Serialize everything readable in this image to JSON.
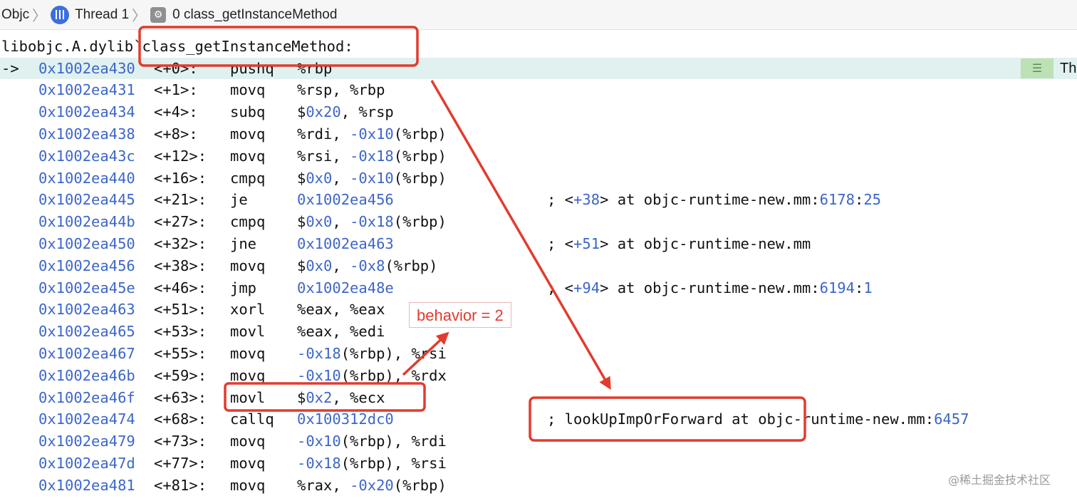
{
  "breadcrumb": {
    "items": [
      "Objc",
      "Thread 1",
      "0 class_getInstanceMethod"
    ],
    "separator": "〉"
  },
  "disassembly": {
    "function_header": "libobjc.A.dylib`class_getInstanceMethod:",
    "current_arrow": "->",
    "side_indicator": "Th",
    "rows": [
      {
        "addr": "0x1002ea430",
        "offset": "<+0>:",
        "op": "pushq",
        "args": [
          {
            "t": "%rbp"
          }
        ],
        "comment": [],
        "current": true
      },
      {
        "addr": "0x1002ea431",
        "offset": "<+1>:",
        "op": "movq",
        "args": [
          {
            "t": "%rsp, %rbp"
          }
        ],
        "comment": []
      },
      {
        "addr": "0x1002ea434",
        "offset": "<+4>:",
        "op": "subq",
        "args": [
          {
            "t": "$"
          },
          {
            "t": "0x20",
            "n": true
          },
          {
            "t": ", %rsp"
          }
        ],
        "comment": []
      },
      {
        "addr": "0x1002ea438",
        "offset": "<+8>:",
        "op": "movq",
        "args": [
          {
            "t": "%rdi, "
          },
          {
            "t": "-0x10",
            "n": true
          },
          {
            "t": "(%rbp)"
          }
        ],
        "comment": []
      },
      {
        "addr": "0x1002ea43c",
        "offset": "<+12>:",
        "op": "movq",
        "args": [
          {
            "t": "%rsi, "
          },
          {
            "t": "-0x18",
            "n": true
          },
          {
            "t": "(%rbp)"
          }
        ],
        "comment": []
      },
      {
        "addr": "0x1002ea440",
        "offset": "<+16>:",
        "op": "cmpq",
        "args": [
          {
            "t": "$"
          },
          {
            "t": "0x0",
            "n": true
          },
          {
            "t": ", "
          },
          {
            "t": "-0x10",
            "n": true
          },
          {
            "t": "(%rbp)"
          }
        ],
        "comment": []
      },
      {
        "addr": "0x1002ea445",
        "offset": "<+21>:",
        "op": "je",
        "args": [
          {
            "t": "0x1002ea456",
            "n": true
          }
        ],
        "comment": [
          {
            "t": "; <"
          },
          {
            "t": "+38",
            "n": true
          },
          {
            "t": "> at objc-runtime-new.mm:"
          },
          {
            "t": "6178",
            "n": true
          },
          {
            "t": ":"
          },
          {
            "t": "25",
            "n": true
          }
        ]
      },
      {
        "addr": "0x1002ea44b",
        "offset": "<+27>:",
        "op": "cmpq",
        "args": [
          {
            "t": "$"
          },
          {
            "t": "0x0",
            "n": true
          },
          {
            "t": ", "
          },
          {
            "t": "-0x18",
            "n": true
          },
          {
            "t": "(%rbp)"
          }
        ],
        "comment": []
      },
      {
        "addr": "0x1002ea450",
        "offset": "<+32>:",
        "op": "jne",
        "args": [
          {
            "t": "0x1002ea463",
            "n": true
          }
        ],
        "comment": [
          {
            "t": "; <"
          },
          {
            "t": "+51",
            "n": true
          },
          {
            "t": "> at objc-runtime-new.mm"
          }
        ]
      },
      {
        "addr": "0x1002ea456",
        "offset": "<+38>:",
        "op": "movq",
        "args": [
          {
            "t": "$"
          },
          {
            "t": "0x0",
            "n": true
          },
          {
            "t": ", "
          },
          {
            "t": "-0x8",
            "n": true
          },
          {
            "t": "(%rbp)"
          }
        ],
        "comment": []
      },
      {
        "addr": "0x1002ea45e",
        "offset": "<+46>:",
        "op": "jmp",
        "args": [
          {
            "t": "0x1002ea48e",
            "n": true
          }
        ],
        "comment": [
          {
            "t": "; <"
          },
          {
            "t": "+94",
            "n": true
          },
          {
            "t": "> at objc-runtime-new.mm:"
          },
          {
            "t": "6194",
            "n": true
          },
          {
            "t": ":"
          },
          {
            "t": "1",
            "n": true
          }
        ]
      },
      {
        "addr": "0x1002ea463",
        "offset": "<+51>:",
        "op": "xorl",
        "args": [
          {
            "t": "%eax, %eax"
          }
        ],
        "comment": []
      },
      {
        "addr": "0x1002ea465",
        "offset": "<+53>:",
        "op": "movl",
        "args": [
          {
            "t": "%eax, %edi"
          }
        ],
        "comment": []
      },
      {
        "addr": "0x1002ea467",
        "offset": "<+55>:",
        "op": "movq",
        "args": [
          {
            "t": "-0x18",
            "n": true
          },
          {
            "t": "(%rbp), %rsi"
          }
        ],
        "comment": []
      },
      {
        "addr": "0x1002ea46b",
        "offset": "<+59>:",
        "op": "movq",
        "args": [
          {
            "t": "-0x10",
            "n": true
          },
          {
            "t": "(%rbp), %rdx"
          }
        ],
        "comment": []
      },
      {
        "addr": "0x1002ea46f",
        "offset": "<+63>:",
        "op": "movl",
        "args": [
          {
            "t": "$"
          },
          {
            "t": "0x2",
            "n": true
          },
          {
            "t": ", %ecx"
          }
        ],
        "comment": []
      },
      {
        "addr": "0x1002ea474",
        "offset": "<+68>:",
        "op": "callq",
        "args": [
          {
            "t": "0x100312dc0",
            "n": true
          }
        ],
        "comment": [
          {
            "t": "; lookUpImpOrForward at objc-runtime-new.mm:"
          },
          {
            "t": "6457",
            "n": true
          }
        ]
      },
      {
        "addr": "0x1002ea479",
        "offset": "<+73>:",
        "op": "movq",
        "args": [
          {
            "t": "-0x10",
            "n": true
          },
          {
            "t": "(%rbp), %rdi"
          }
        ],
        "comment": []
      },
      {
        "addr": "0x1002ea47d",
        "offset": "<+77>:",
        "op": "movq",
        "args": [
          {
            "t": "-0x18",
            "n": true
          },
          {
            "t": "(%rbp), %rsi"
          }
        ],
        "comment": []
      },
      {
        "addr": "0x1002ea481",
        "offset": "<+81>:",
        "op": "movq",
        "args": [
          {
            "t": "%rax, "
          },
          {
            "t": "-0x20",
            "n": true
          },
          {
            "t": "(%rbp)"
          }
        ],
        "comment": []
      }
    ]
  },
  "annotations": {
    "callout_text": "behavior = 2",
    "color": "#e23b2e"
  },
  "watermark": "@稀土掘金技术社区",
  "colors": {
    "address": "#3c66c9",
    "current_line": "#e0f1ef",
    "annotation": "#e23b2e"
  }
}
